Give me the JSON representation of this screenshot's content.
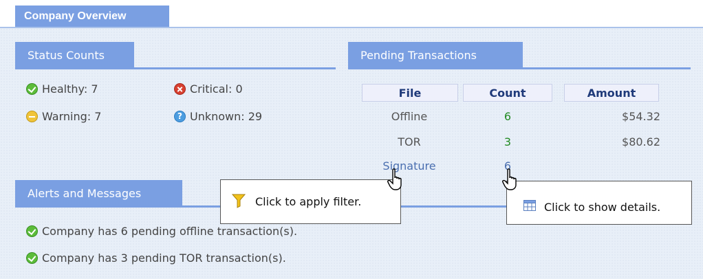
{
  "tabs": {
    "company_overview": "Company Overview"
  },
  "status_counts": {
    "title": "Status Counts",
    "healthy": "Healthy: 7",
    "warning": "Warning: 7",
    "critical": "Critical: 0",
    "unknown": "Unknown: 29"
  },
  "pending": {
    "title": "Pending Transactions",
    "headers": [
      "File",
      "Count",
      "Amount"
    ],
    "rows": [
      {
        "file": "Offline",
        "count": "6",
        "amount": "$54.32"
      },
      {
        "file": "TOR",
        "count": "3",
        "amount": "$80.62"
      },
      {
        "file": "Signature",
        "count": "6",
        "amount": ""
      }
    ]
  },
  "alerts": {
    "title": "Alerts and Messages",
    "messages": [
      "Company has 6 pending offline transaction(s).",
      "Company has 3 pending TOR transaction(s)."
    ]
  },
  "tooltips": {
    "filter": "Click to apply filter.",
    "details": "Click to show details."
  },
  "icons": {
    "healthy": "check-circle-icon",
    "warning": "minus-circle-icon",
    "critical": "x-circle-icon",
    "unknown": "question-circle-icon",
    "filter": "funnel-icon",
    "details": "table-icon",
    "cursor": "hand-pointer-icon"
  },
  "colors": {
    "header_blue": "#7a9fe2",
    "panel_bg": "#e8eff8",
    "count_green": "#238b23",
    "signature_blue": "#4a6fb0"
  }
}
